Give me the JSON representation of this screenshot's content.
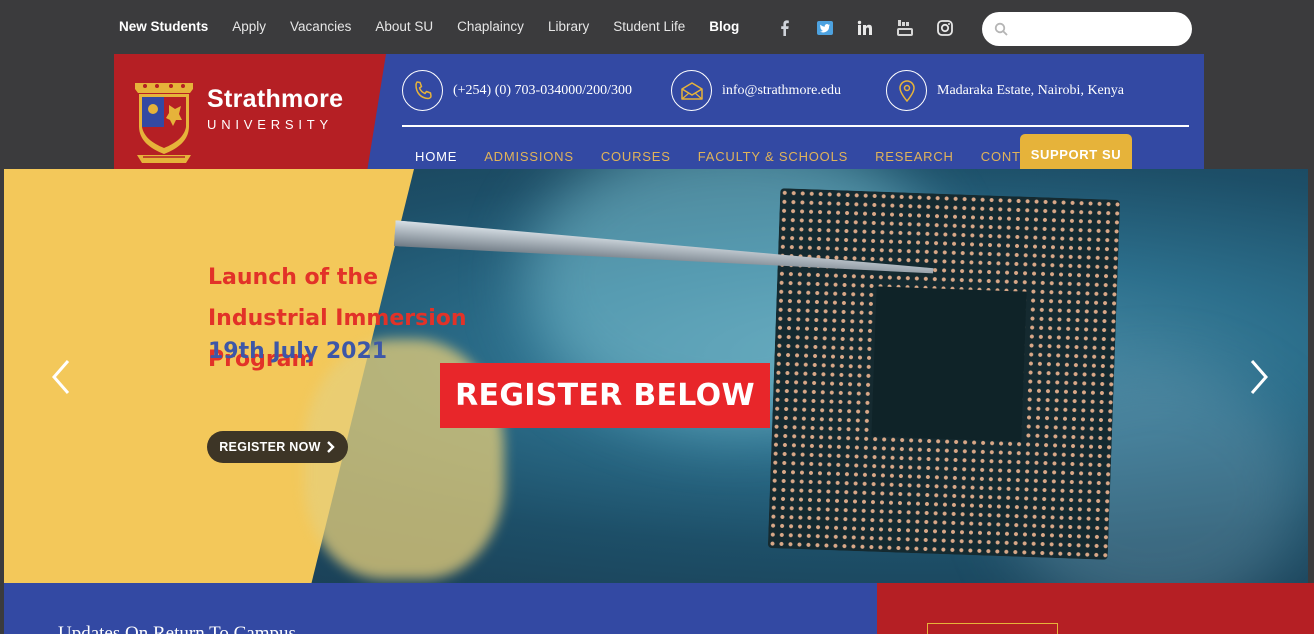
{
  "topbar": {
    "links": [
      {
        "label": "New Students",
        "bold": true
      },
      {
        "label": "Apply",
        "bold": false
      },
      {
        "label": "Vacancies",
        "bold": false
      },
      {
        "label": "About SU",
        "bold": false
      },
      {
        "label": "Chaplaincy",
        "bold": false
      },
      {
        "label": "Library",
        "bold": false
      },
      {
        "label": "Student Life",
        "bold": false
      },
      {
        "label": "Blog",
        "bold": true
      }
    ],
    "social_icons": [
      "facebook-icon",
      "twitter-icon",
      "linkedin-icon",
      "youtube-icon",
      "instagram-icon"
    ],
    "search": {
      "placeholder": "",
      "value": ""
    }
  },
  "header": {
    "logo": {
      "name": "Strathmore",
      "subtitle": "UNIVERSITY"
    },
    "phone": "(+254) (0) 703-034000/200/300",
    "email": "info@strathmore.edu",
    "address": "Madaraka Estate, Nairobi, Kenya",
    "nav": [
      {
        "label": "HOME",
        "active": true
      },
      {
        "label": "ADMISSIONS",
        "active": false
      },
      {
        "label": "COURSES",
        "active": false
      },
      {
        "label": "FACULTY & SCHOOLS",
        "active": false
      },
      {
        "label": "RESEARCH",
        "active": false
      },
      {
        "label": "CONTACT",
        "active": false
      }
    ],
    "support_label": "SUPPORT SU"
  },
  "hero": {
    "title": "Launch of the Industrial Immersion Program",
    "date": "19th July 2021",
    "register_now": "REGISTER NOW",
    "banner": "REGISTER BELOW"
  },
  "bottom": {
    "updates_title": "Updates On Return To Campus"
  },
  "colors": {
    "brand_blue": "#3349a3",
    "brand_red": "#b51f24",
    "gold": "#e6b33a",
    "nav_gold": "#e0b35a",
    "hero_title_red": "#e23228",
    "hero_date_blue": "#3d57a7"
  }
}
